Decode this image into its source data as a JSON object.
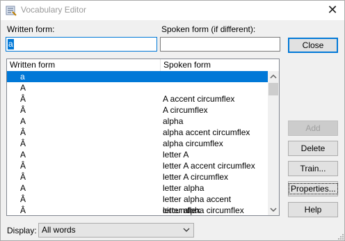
{
  "window": {
    "title": "Vocabulary Editor",
    "close_glyph": "✕"
  },
  "fields": {
    "written_label": "Written form:",
    "written_value": "a",
    "spoken_label": "Spoken form (if different):",
    "spoken_value": ""
  },
  "buttons": {
    "close": "Close",
    "add": "Add",
    "delete": "Delete",
    "train": "Train...",
    "properties": "Properties...",
    "help": "Help"
  },
  "list": {
    "columns": [
      "Written form",
      "Spoken form"
    ],
    "rows": [
      {
        "written": "a",
        "spoken": ""
      },
      {
        "written": "A",
        "spoken": ""
      },
      {
        "written": "Â",
        "spoken": "A accent circumflex"
      },
      {
        "written": "Â",
        "spoken": "A circumflex"
      },
      {
        "written": "A",
        "spoken": "alpha"
      },
      {
        "written": "Â",
        "spoken": "alpha accent circumflex"
      },
      {
        "written": "Â",
        "spoken": "alpha circumflex"
      },
      {
        "written": "A",
        "spoken": "letter A"
      },
      {
        "written": "Â",
        "spoken": "letter A accent circumflex"
      },
      {
        "written": "Â",
        "spoken": "letter A circumflex"
      },
      {
        "written": "A",
        "spoken": "letter alpha"
      },
      {
        "written": "Â",
        "spoken": "letter alpha accent circumflex"
      },
      {
        "written": "Â",
        "spoken": "letter alpha circumflex"
      }
    ],
    "selected_index": 0
  },
  "display": {
    "label": "Display:",
    "value": "All words"
  },
  "colors": {
    "accent": "#0078d7",
    "window_bg": "#f0f0f0"
  },
  "icons": {
    "app": "vocabulary-editor-icon",
    "close": "close-icon",
    "dropdown": "chevron-down-icon"
  }
}
